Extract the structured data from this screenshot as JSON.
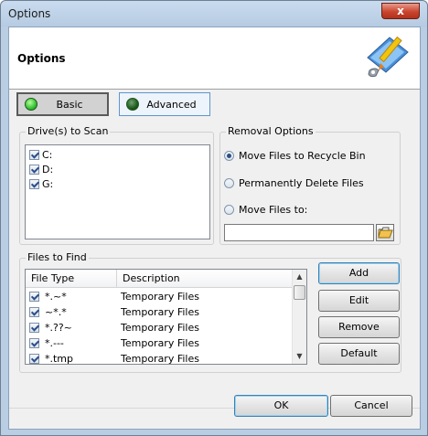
{
  "window": {
    "title": "Options",
    "close_symbol": "x"
  },
  "header": {
    "title": "Options",
    "icon": "paint-brush-tools-icon"
  },
  "modes": [
    {
      "label": "Basic",
      "state": "active"
    },
    {
      "label": "Advanced",
      "state": "inactive"
    }
  ],
  "drives": {
    "label": "Drive(s) to Scan",
    "items": [
      {
        "label": "C:",
        "checked": true
      },
      {
        "label": "D:",
        "checked": true
      },
      {
        "label": "G:",
        "checked": true
      }
    ]
  },
  "removal": {
    "label": "Removal Options",
    "options": [
      {
        "label": "Move Files to Recycle Bin",
        "selected": true
      },
      {
        "label": "Permanently Delete Files",
        "selected": false
      },
      {
        "label": "Move Files to:",
        "selected": false
      }
    ],
    "move_path_value": ""
  },
  "files": {
    "label": "Files to Find",
    "columns": [
      "File Type",
      "Description"
    ],
    "rows": [
      {
        "type": "*.~*",
        "desc": "Temporary Files",
        "checked": true
      },
      {
        "type": "~*.*",
        "desc": "Temporary Files",
        "checked": true
      },
      {
        "type": "*.??~",
        "desc": "Temporary Files",
        "checked": true
      },
      {
        "type": "*.---",
        "desc": "Temporary Files",
        "checked": true
      },
      {
        "type": "*.tmp",
        "desc": "Temporary Files",
        "checked": true
      }
    ],
    "buttons": {
      "add": "Add",
      "edit": "Edit",
      "remove": "Remove",
      "default": "Default"
    }
  },
  "footer": {
    "ok": "OK",
    "cancel": "Cancel"
  }
}
